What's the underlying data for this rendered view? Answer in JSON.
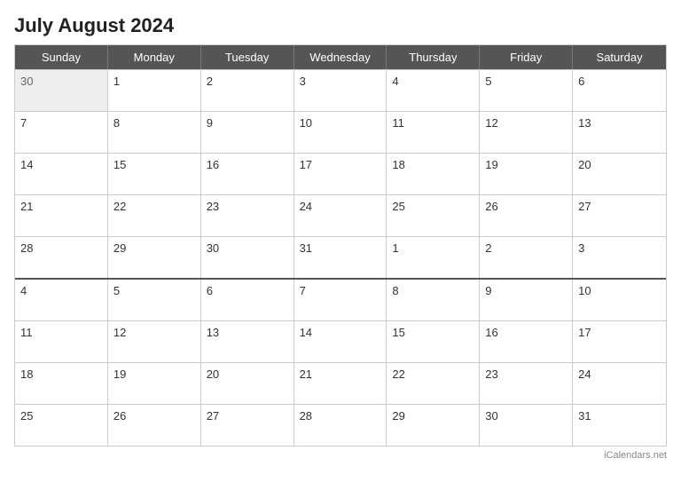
{
  "title": "July August 2024",
  "header": {
    "days": [
      "Sunday",
      "Monday",
      "Tuesday",
      "Wednesday",
      "Thursday",
      "Friday",
      "Saturday"
    ]
  },
  "weeks": [
    {
      "monthDivider": false,
      "days": [
        {
          "num": "30",
          "type": "prev-month"
        },
        {
          "num": "1",
          "type": "current"
        },
        {
          "num": "2",
          "type": "current"
        },
        {
          "num": "3",
          "type": "current"
        },
        {
          "num": "4",
          "type": "current"
        },
        {
          "num": "5",
          "type": "current"
        },
        {
          "num": "6",
          "type": "current"
        }
      ]
    },
    {
      "monthDivider": false,
      "days": [
        {
          "num": "7",
          "type": "current"
        },
        {
          "num": "8",
          "type": "current"
        },
        {
          "num": "9",
          "type": "current"
        },
        {
          "num": "10",
          "type": "current"
        },
        {
          "num": "11",
          "type": "current"
        },
        {
          "num": "12",
          "type": "current"
        },
        {
          "num": "13",
          "type": "current"
        }
      ]
    },
    {
      "monthDivider": false,
      "days": [
        {
          "num": "14",
          "type": "current"
        },
        {
          "num": "15",
          "type": "current"
        },
        {
          "num": "16",
          "type": "current"
        },
        {
          "num": "17",
          "type": "current"
        },
        {
          "num": "18",
          "type": "current"
        },
        {
          "num": "19",
          "type": "current"
        },
        {
          "num": "20",
          "type": "current"
        }
      ]
    },
    {
      "monthDivider": false,
      "days": [
        {
          "num": "21",
          "type": "current"
        },
        {
          "num": "22",
          "type": "current"
        },
        {
          "num": "23",
          "type": "current"
        },
        {
          "num": "24",
          "type": "current"
        },
        {
          "num": "25",
          "type": "current"
        },
        {
          "num": "26",
          "type": "current"
        },
        {
          "num": "27",
          "type": "current"
        }
      ]
    },
    {
      "monthDivider": false,
      "days": [
        {
          "num": "28",
          "type": "current"
        },
        {
          "num": "29",
          "type": "current"
        },
        {
          "num": "30",
          "type": "current"
        },
        {
          "num": "31",
          "type": "current"
        },
        {
          "num": "1",
          "type": "next-month"
        },
        {
          "num": "2",
          "type": "next-month"
        },
        {
          "num": "3",
          "type": "next-month"
        }
      ]
    },
    {
      "monthDivider": true,
      "days": [
        {
          "num": "4",
          "type": "current"
        },
        {
          "num": "5",
          "type": "current"
        },
        {
          "num": "6",
          "type": "current"
        },
        {
          "num": "7",
          "type": "current"
        },
        {
          "num": "8",
          "type": "current"
        },
        {
          "num": "9",
          "type": "current"
        },
        {
          "num": "10",
          "type": "current"
        }
      ]
    },
    {
      "monthDivider": false,
      "days": [
        {
          "num": "11",
          "type": "current"
        },
        {
          "num": "12",
          "type": "current"
        },
        {
          "num": "13",
          "type": "current"
        },
        {
          "num": "14",
          "type": "current"
        },
        {
          "num": "15",
          "type": "current"
        },
        {
          "num": "16",
          "type": "current"
        },
        {
          "num": "17",
          "type": "current"
        }
      ]
    },
    {
      "monthDivider": false,
      "days": [
        {
          "num": "18",
          "type": "current"
        },
        {
          "num": "19",
          "type": "current"
        },
        {
          "num": "20",
          "type": "current"
        },
        {
          "num": "21",
          "type": "current"
        },
        {
          "num": "22",
          "type": "current"
        },
        {
          "num": "23",
          "type": "current"
        },
        {
          "num": "24",
          "type": "current"
        }
      ]
    },
    {
      "monthDivider": false,
      "days": [
        {
          "num": "25",
          "type": "current"
        },
        {
          "num": "26",
          "type": "current"
        },
        {
          "num": "27",
          "type": "current"
        },
        {
          "num": "28",
          "type": "current"
        },
        {
          "num": "29",
          "type": "current"
        },
        {
          "num": "30",
          "type": "current"
        },
        {
          "num": "31",
          "type": "current"
        }
      ]
    }
  ],
  "footer": "iCalendars.net"
}
